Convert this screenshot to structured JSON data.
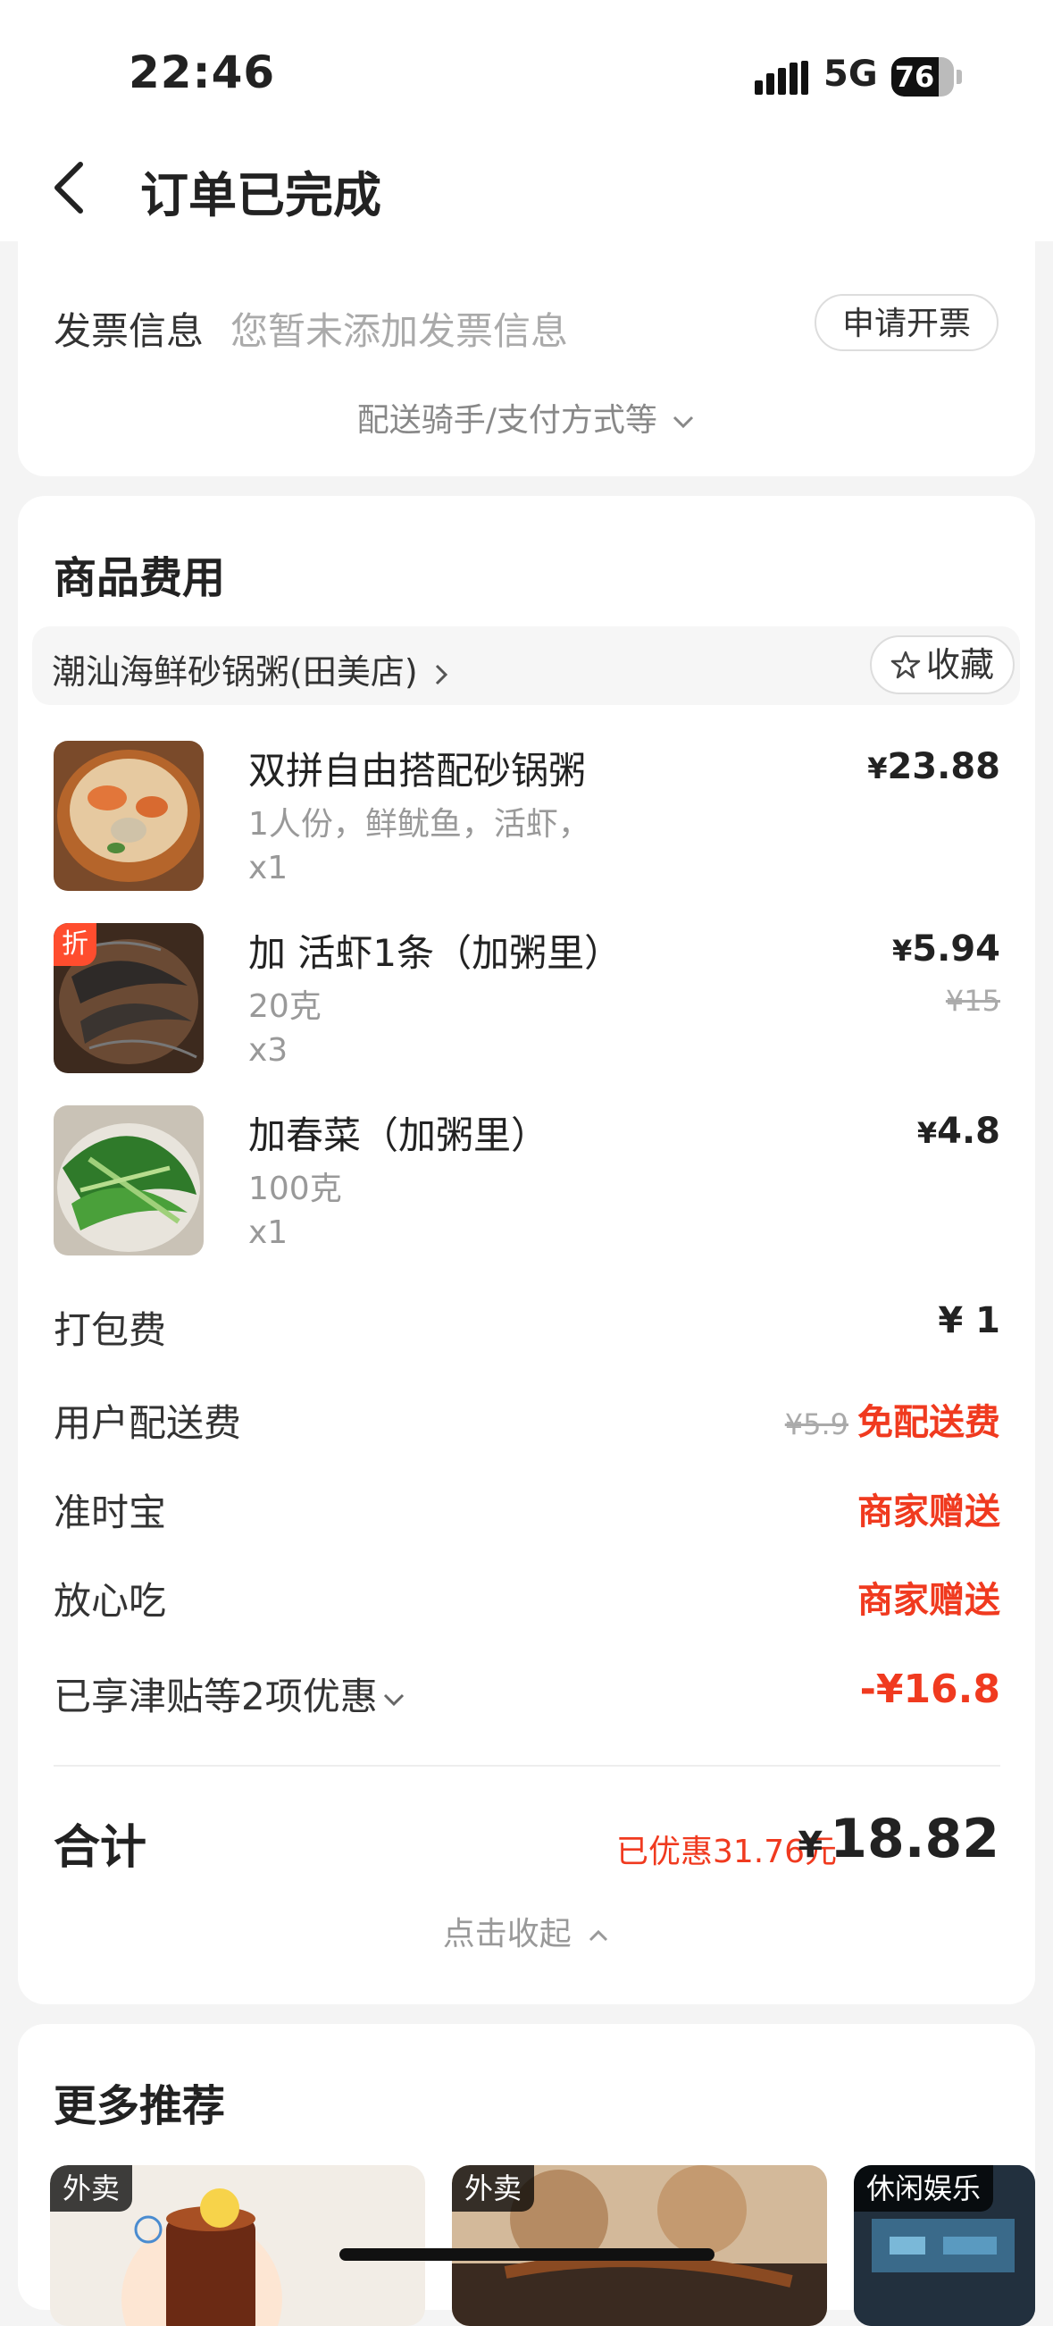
{
  "status_bar": {
    "time": "22:46",
    "network": "5G",
    "battery": "76",
    "battery_level": 0.76
  },
  "header": {
    "title": "订单已完成"
  },
  "invoice": {
    "label": "发票信息",
    "value": "您暂未添加发票信息",
    "button": "申请开票",
    "more": "配送骑手/支付方式等"
  },
  "goods": {
    "title": "商品费用",
    "shop_name": "潮汕海鲜砂锅粥(田美店)",
    "favorite": "收藏",
    "items": [
      {
        "name": "双拼自由搭配砂锅粥",
        "spec": "1人份，鲜鱿鱼，活虾，",
        "qty": "x1",
        "price": "23.88",
        "original": "",
        "discount": ""
      },
      {
        "name": "加 活虾1条（加粥里）",
        "spec": "20克",
        "qty": "x3",
        "price": "5.94",
        "original": "¥15",
        "discount": "折"
      },
      {
        "name": "加春菜（加粥里）",
        "spec": "100克",
        "qty": "x1",
        "price": "4.8",
        "original": "",
        "discount": ""
      }
    ],
    "currency": "¥",
    "fees": {
      "packing": {
        "label": "打包费",
        "value": "¥ 1"
      },
      "delivery": {
        "label": "用户配送费",
        "original": "¥5.9",
        "value": "免配送费"
      },
      "ontime": {
        "label": "准时宝",
        "value": "商家赠送"
      },
      "safe": {
        "label": "放心吃",
        "value": "商家赠送"
      },
      "discounts": {
        "label": "已享津贴等2项优惠",
        "value": "-¥16.8"
      }
    },
    "total": {
      "label": "合计",
      "saved": "已优惠31.76元",
      "currency": "¥",
      "value": "18.82"
    },
    "collapse": "点击收起"
  },
  "recommendations": {
    "title": "更多推荐",
    "tiles": [
      {
        "tag": "外卖"
      },
      {
        "tag": "外卖"
      },
      {
        "tag": "休闲娱乐"
      }
    ]
  },
  "colors": {
    "accent_red": "#f03a1f",
    "discount_tag": "#ff4d2e"
  }
}
